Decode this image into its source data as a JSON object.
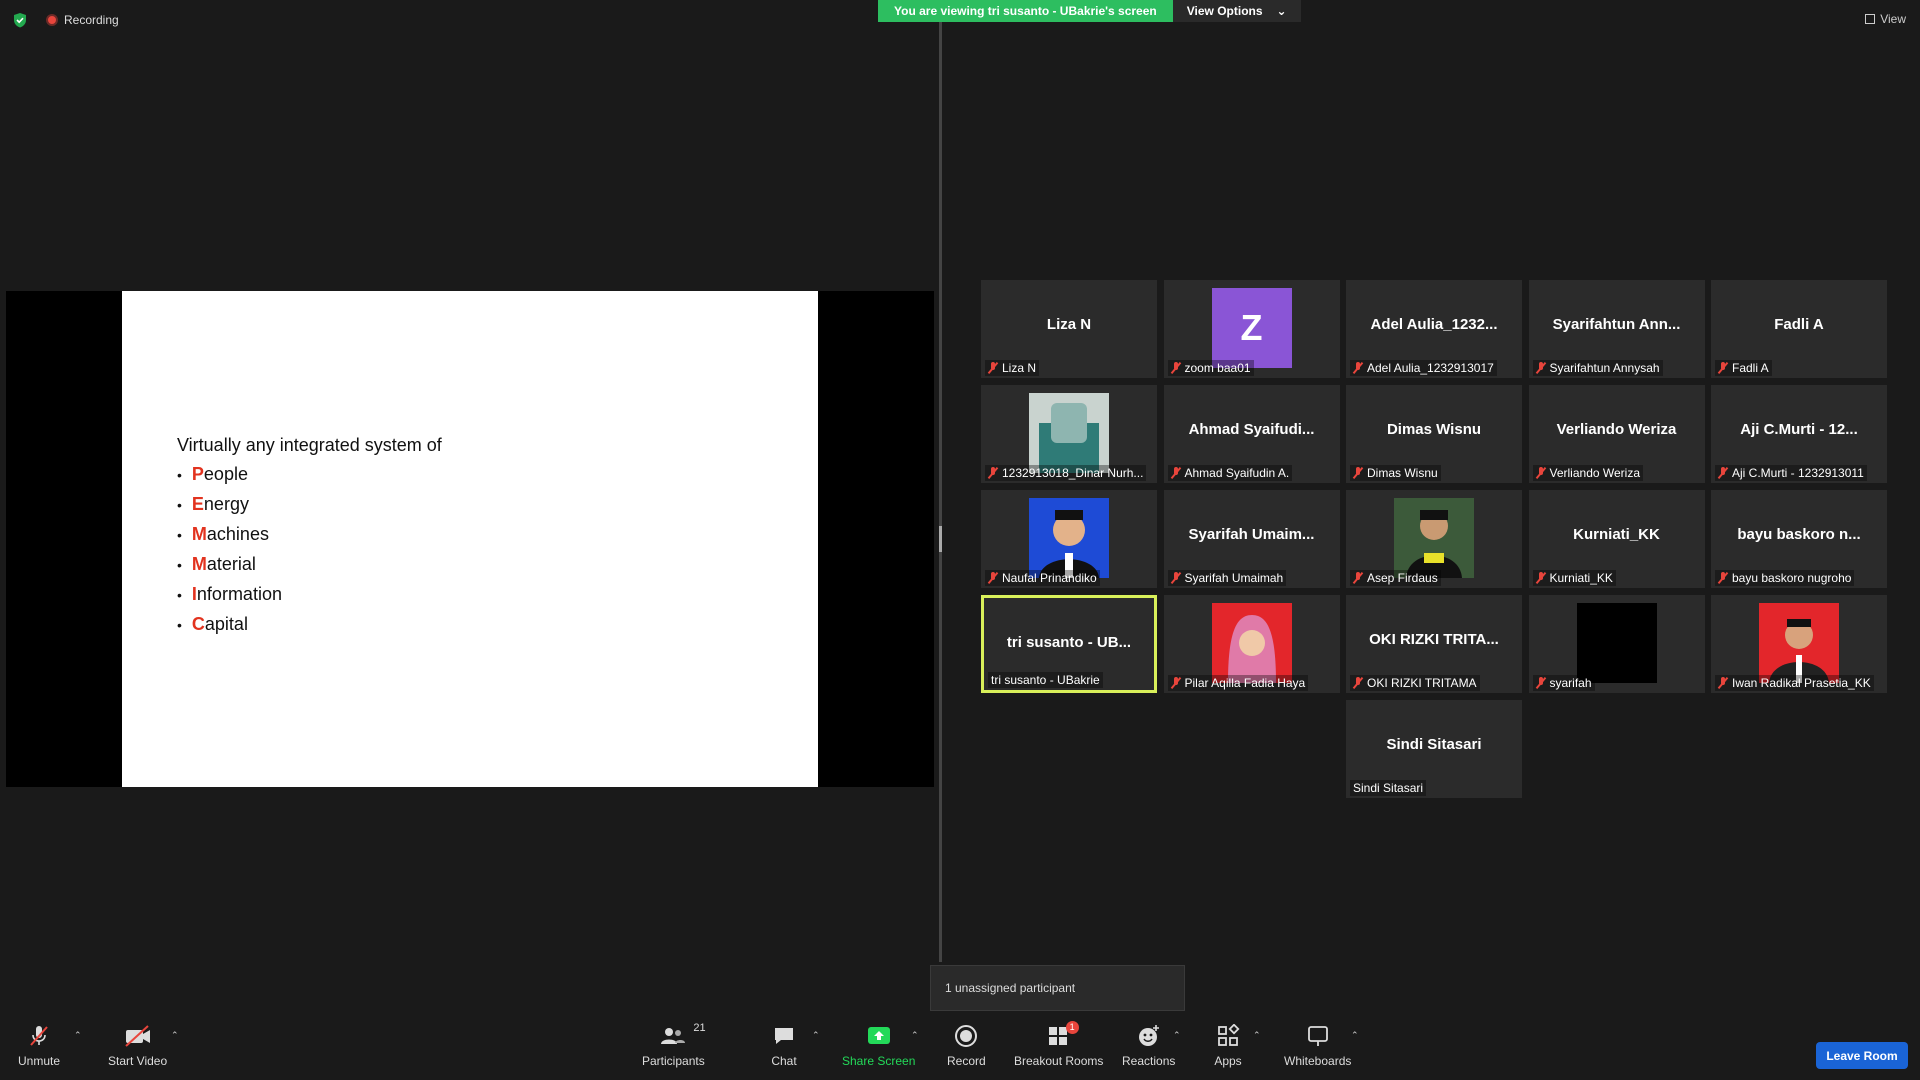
{
  "top": {
    "recording_label": "Recording",
    "viewing_banner": "You are viewing tri susanto - UBakrie's screen",
    "view_options_label": "View Options",
    "view_label": "View"
  },
  "slide": {
    "intro": "Virtually any integrated system of",
    "items": [
      {
        "first": "P",
        "rest": "eople"
      },
      {
        "first": "E",
        "rest": "nergy"
      },
      {
        "first": "M",
        "rest": "achines"
      },
      {
        "first": "M",
        "rest": "aterial"
      },
      {
        "first": "I",
        "rest": "nformation"
      },
      {
        "first": "C",
        "rest": "apital"
      }
    ]
  },
  "gallery": [
    {
      "big": "Liza N",
      "name": "Liza N",
      "muted": true
    },
    {
      "avatar": "Z",
      "name": "zoom baa01",
      "muted": true
    },
    {
      "big": "Adel Aulia_1232...",
      "name": "Adel Aulia_1232913017",
      "muted": true
    },
    {
      "big": "Syarifahtun Ann...",
      "name": "Syarifahtun Annysah",
      "muted": true
    },
    {
      "big": "Fadli A",
      "name": "Fadli A",
      "muted": true
    },
    {
      "photo": "teal",
      "name": "1232913018_Dinar Nurh...",
      "muted": true
    },
    {
      "big": "Ahmad Syaifudi...",
      "name": "Ahmad Syaifudin A.",
      "muted": true
    },
    {
      "big": "Dimas Wisnu",
      "name": "Dimas Wisnu",
      "muted": true
    },
    {
      "big": "Verliando Weriza",
      "name": "Verliando Weriza",
      "muted": true
    },
    {
      "big": "Aji C.Murti - 12...",
      "name": "Aji C.Murti - 1232913011",
      "muted": true
    },
    {
      "photo": "blue",
      "name": "Naufal Prinandiko",
      "muted": true
    },
    {
      "big": "Syarifah Umaim...",
      "name": "Syarifah Umaimah",
      "muted": true
    },
    {
      "photo": "green",
      "name": "Asep Firdaus",
      "muted": true
    },
    {
      "big": "Kurniati_KK",
      "name": "Kurniati_KK",
      "muted": true
    },
    {
      "big": "bayu baskoro n...",
      "name": "bayu baskoro nugroho",
      "muted": true
    },
    {
      "big": "tri susanto - UB...",
      "name": "tri susanto - UBakrie",
      "muted": false,
      "active": true
    },
    {
      "photo": "red-hijab",
      "name": "Pilar Aqilla Fadia Haya",
      "muted": true
    },
    {
      "big": "OKI RIZKI TRITA...",
      "name": "OKI RIZKI TRITAMA",
      "muted": true
    },
    {
      "photo": "black",
      "name": "syarifah",
      "muted": true
    },
    {
      "photo": "red",
      "name": "Iwan Radikal Prasetia_KK",
      "muted": true
    },
    {
      "big": "Sindi Sitasari",
      "name": "Sindi Sitasari",
      "muted": false
    }
  ],
  "popup": {
    "unassigned": "1 unassigned participant"
  },
  "toolbar": {
    "unmute": "Unmute",
    "start_video": "Start Video",
    "participants": "Participants",
    "participants_count": "21",
    "chat": "Chat",
    "share_screen": "Share Screen",
    "record": "Record",
    "breakout_rooms": "Breakout Rooms",
    "breakout_badge": "1",
    "reactions": "Reactions",
    "apps": "Apps",
    "whiteboards": "Whiteboards",
    "leave_room": "Leave Room"
  },
  "colors": {
    "accent_green": "#23d959",
    "muted_red": "#e8453c",
    "active_border": "#d9f05a",
    "leave_blue": "#1a64d6",
    "slide_letter": "#e2331f"
  }
}
